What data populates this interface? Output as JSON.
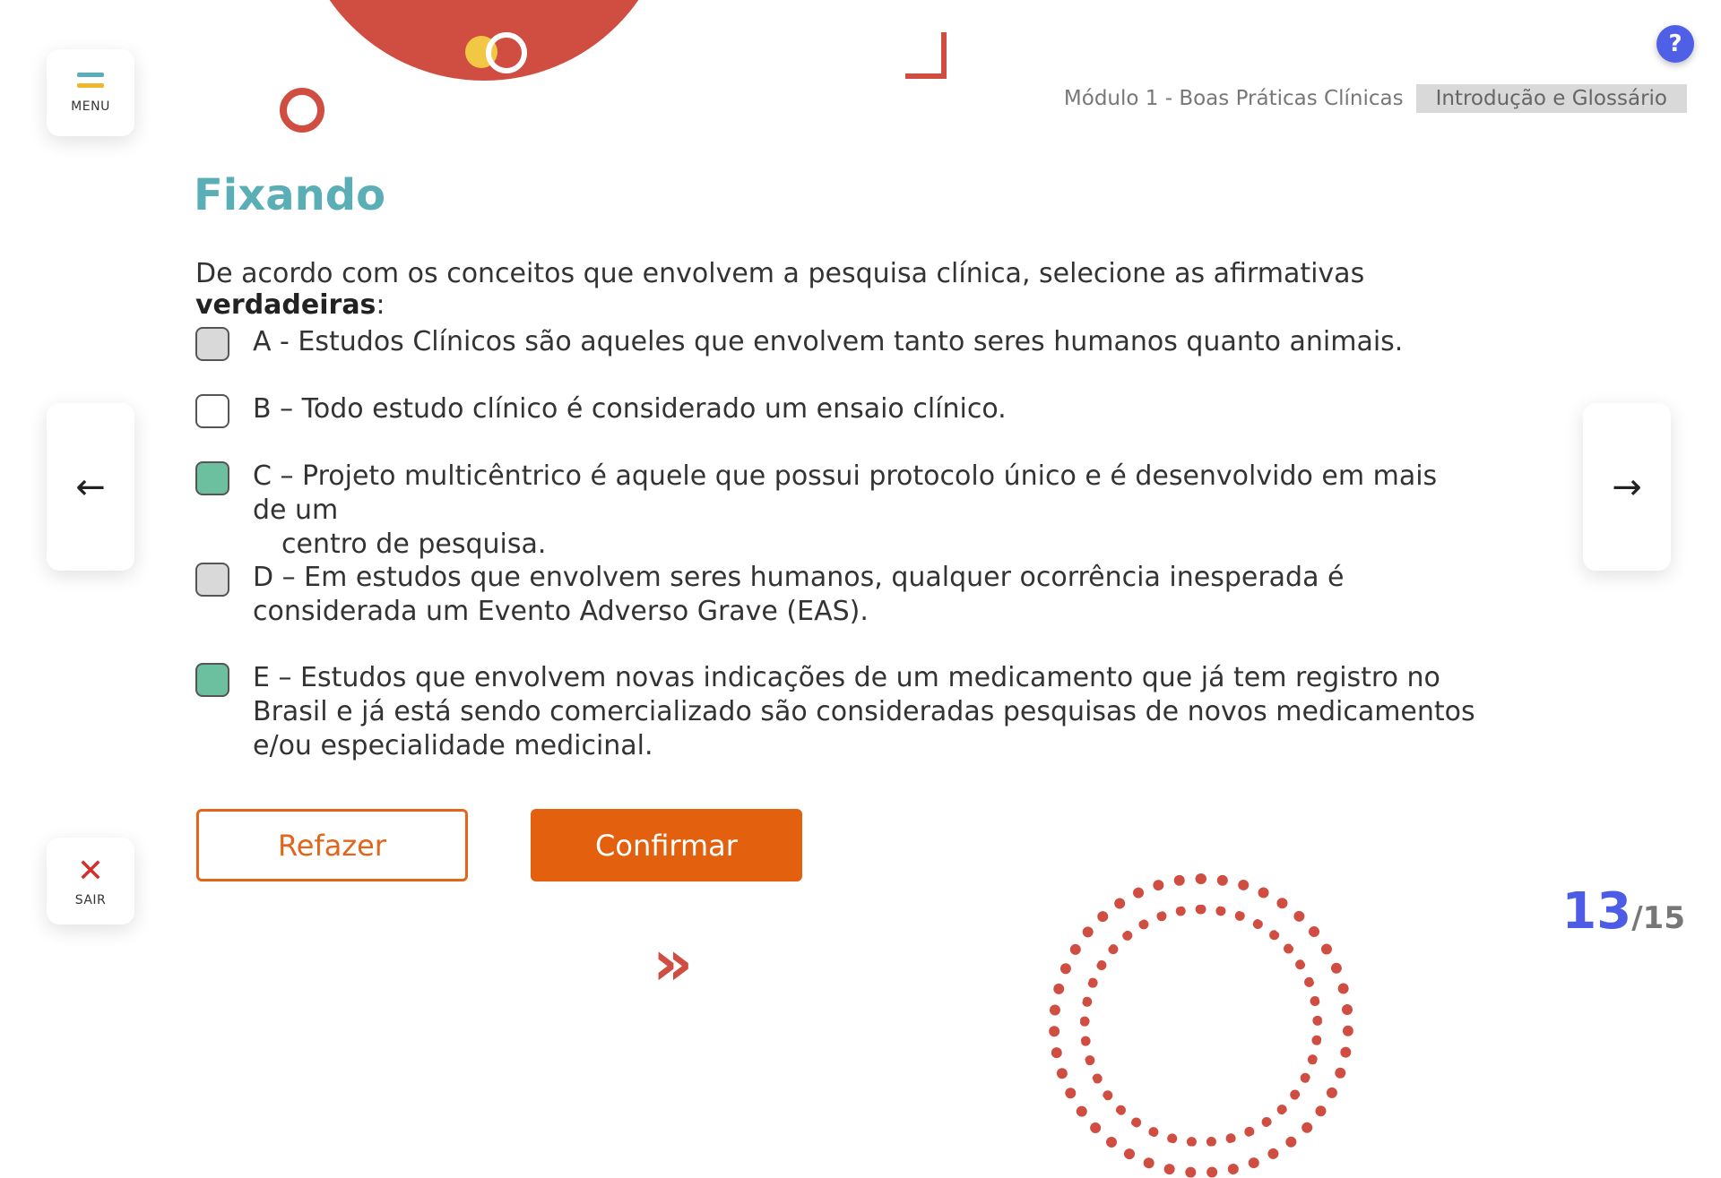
{
  "menu": {
    "label": "MENU",
    "icon": "menu-icon"
  },
  "exit": {
    "label": "SAIR",
    "icon": "close-icon"
  },
  "help": {
    "label": "?"
  },
  "breadcrumb": {
    "module": "Módulo 1 - Boas Práticas Clínicas",
    "section": "Introdução e Glossário"
  },
  "title": "Fixando",
  "question": {
    "prefix": "De acordo com os conceitos que envolvem a pesquisa clínica, selecione as afirmativas ",
    "emphasis": "verdadeiras",
    "suffix": ":"
  },
  "options": [
    {
      "text": "A - Estudos Clínicos são aqueles que envolvem tanto seres humanos quanto animais.",
      "state": "gray"
    },
    {
      "text": "B – Todo estudo clínico é considerado um ensaio clínico.",
      "state": "unchecked"
    },
    {
      "text": "C – Projeto multicêntrico é aquele que possui protocolo único e é desenvolvido em mais de um",
      "text_cont": "centro de pesquisa.",
      "state": "green"
    },
    {
      "text": "D – Em estudos que envolvem seres humanos, qualquer ocorrência inesperada é considerada um Evento Adverso Grave (EAS).",
      "state": "gray"
    },
    {
      "text": "E – Estudos que envolvem novas indicações de um medicamento que já tem registro no Brasil e já está sendo comercializado são consideradas pesquisas de novos medicamentos e/ou especialidade medicinal.",
      "state": "green"
    }
  ],
  "buttons": {
    "redo": "Refazer",
    "confirm": "Confirmar"
  },
  "navigation": {
    "prev_icon": "arrow-left-icon",
    "next_icon": "arrow-right-icon",
    "prev_glyph": "←",
    "next_glyph": "→"
  },
  "page": {
    "current": "13",
    "total": "/15"
  },
  "colors": {
    "accent": "#5aaeb5",
    "primary_action": "#e2600e",
    "decor": "#cf4d41",
    "checked": "#6cbf9f",
    "counter": "#4d5ce6"
  }
}
